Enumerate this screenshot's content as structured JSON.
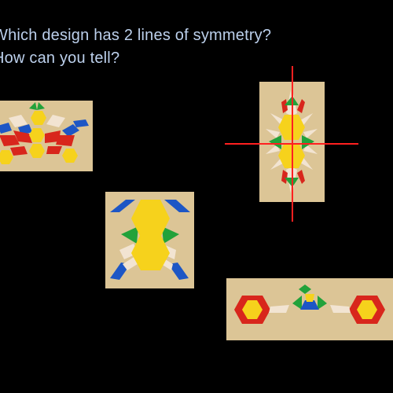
{
  "slide": {
    "question_line1": "Which design has 2 lines of symmetry?",
    "question_line2": "How can you tell?"
  },
  "colors": {
    "background": "#000000",
    "text": "#bcd0ec",
    "board": "#dcc596",
    "hexagon": "#f6d21c",
    "trapezoid": "#d8261c",
    "rhombus_blue": "#1d56c5",
    "triangle_green": "#22a23a",
    "rhombus_tan": "#f2e4d2",
    "symmetry_line": "#ff2020"
  },
  "designs": [
    {
      "name": "design-wings",
      "symmetry_lines_drawn": 0
    },
    {
      "name": "design-two-hexagons",
      "symmetry_lines_drawn": 0
    },
    {
      "name": "design-vertical",
      "symmetry_lines_drawn": 2
    },
    {
      "name": "design-flowers",
      "symmetry_lines_drawn": 0
    }
  ]
}
